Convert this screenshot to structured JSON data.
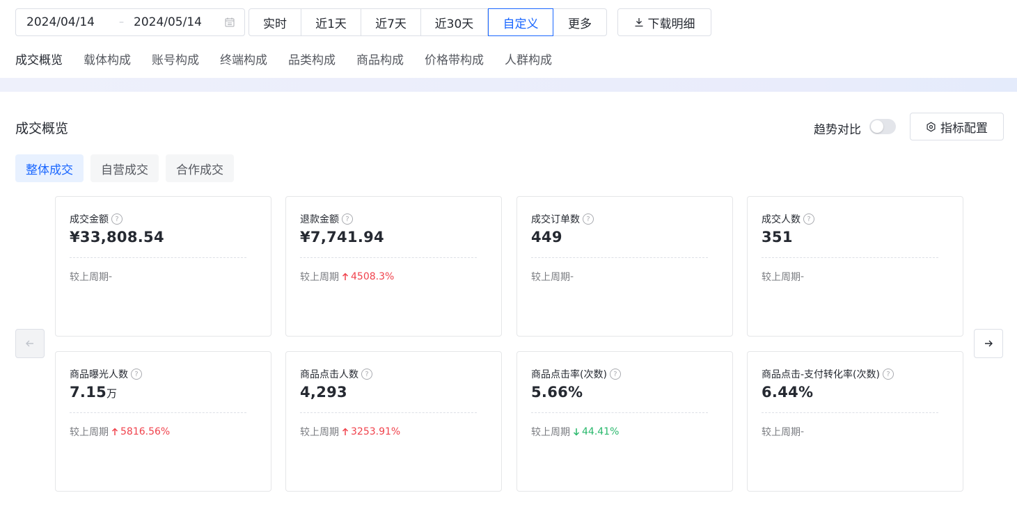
{
  "date_range": {
    "start": "2024/04/14",
    "separator": "–",
    "end": "2024/05/14"
  },
  "time_options": [
    {
      "label": "实时",
      "active": false
    },
    {
      "label": "近1天",
      "active": false
    },
    {
      "label": "近7天",
      "active": false
    },
    {
      "label": "近30天",
      "active": false
    },
    {
      "label": "自定义",
      "active": true
    },
    {
      "label": "更多",
      "active": false
    }
  ],
  "download_label": "下载明细",
  "subnav": [
    "成交概览",
    "载体构成",
    "账号构成",
    "终端构成",
    "品类构成",
    "商品构成",
    "价格带构成",
    "人群构成"
  ],
  "section_title": "成交概览",
  "trend_compare_label": "趋势对比",
  "trend_compare_on": false,
  "config_label": "指标配置",
  "tabs": [
    "整体成交",
    "自营成交",
    "合作成交"
  ],
  "compare_prefix": "较上周期",
  "metrics": [
    {
      "label": "成交金额",
      "value": "¥33,808.54",
      "unit": "",
      "change": "-",
      "direction": "none"
    },
    {
      "label": "退款金额",
      "value": "¥7,741.94",
      "unit": "",
      "change": "4508.3%",
      "direction": "up"
    },
    {
      "label": "成交订单数",
      "value": "449",
      "unit": "",
      "change": "-",
      "direction": "none"
    },
    {
      "label": "成交人数",
      "value": "351",
      "unit": "",
      "change": "-",
      "direction": "none"
    },
    {
      "label": "商品曝光人数",
      "value": "7.15",
      "unit": "万",
      "change": "5816.56%",
      "direction": "up"
    },
    {
      "label": "商品点击人数",
      "value": "4,293",
      "unit": "",
      "change": "3253.91%",
      "direction": "up"
    },
    {
      "label": "商品点击率(次数)",
      "value": "5.66%",
      "unit": "",
      "change": "44.41%",
      "direction": "down"
    },
    {
      "label": "商品点击-支付转化率(次数)",
      "value": "6.44%",
      "unit": "",
      "change": "-",
      "direction": "none"
    }
  ],
  "colors": {
    "accent": "#1966ff",
    "up": "#f0424c",
    "down": "#29b86c"
  },
  "icons": [
    "calendar-icon",
    "download-icon",
    "settings-icon",
    "help-icon",
    "arrow-left-icon",
    "arrow-right-icon",
    "arrow-up-icon",
    "arrow-down-icon"
  ]
}
